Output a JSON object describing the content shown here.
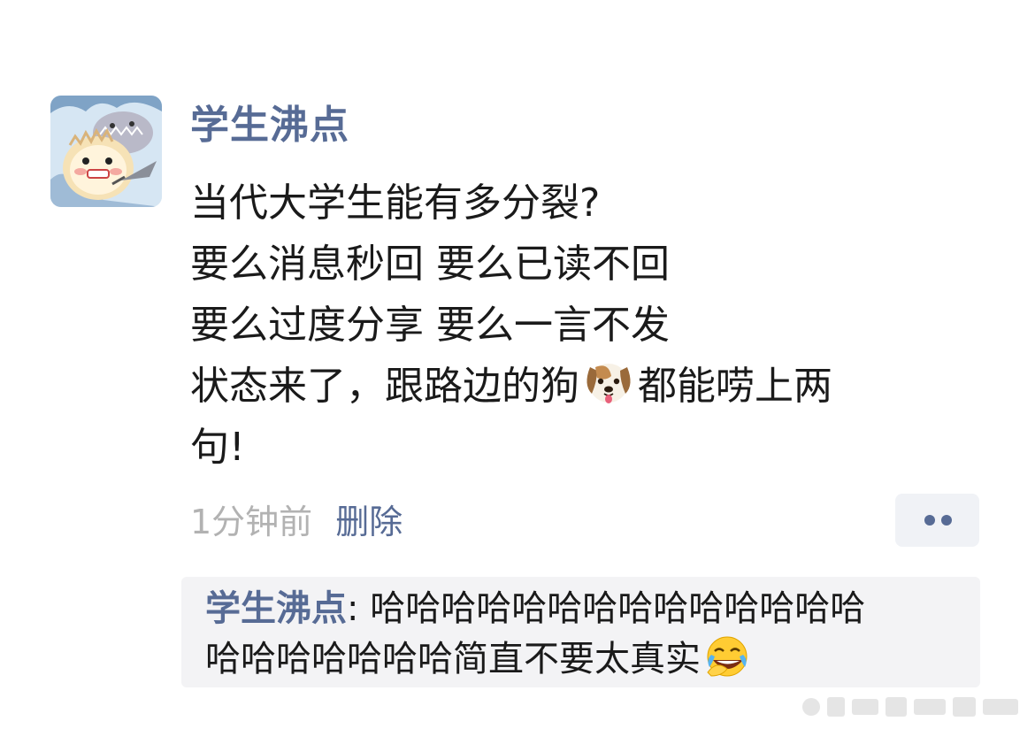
{
  "post": {
    "nickname": "学生沸点",
    "content_lines": [
      "当代大学生能有多分裂?",
      "要么消息秒回 要么已读不回",
      "要么过度分享 要么一言不发"
    ],
    "line4_before_emoji": "状态来了，跟路边的狗",
    "line4_after_emoji": "都能唠上两",
    "line5": "句!",
    "time": "1分钟前",
    "delete_label": "删除"
  },
  "comment": {
    "author": "学生沸点",
    "separator": ": ",
    "line1_text": "哈哈哈哈哈哈哈哈哈哈哈哈哈哈",
    "line2_text": "哈哈哈哈哈哈哈简直不要太真实"
  },
  "icons": {
    "avatar": "cartoon-hamster-avatar",
    "dog_emoji": "dog-face-emoji",
    "laughing_emoji": "rolling-laughing-emoji",
    "more": "more-dots-icon"
  },
  "colors": {
    "link_blue": "#576b95",
    "text": "#1a1a1a",
    "muted": "#b2b2b2",
    "comment_bg": "#f3f3f5"
  }
}
